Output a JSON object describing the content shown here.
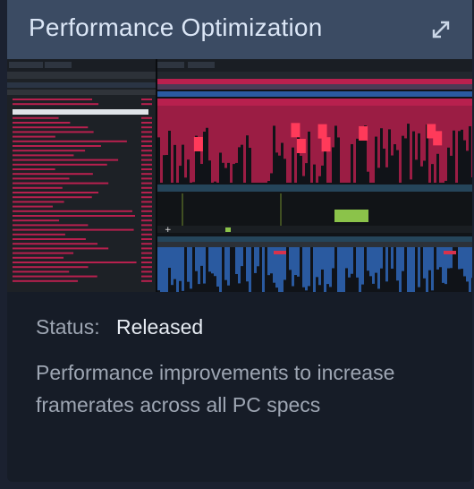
{
  "card": {
    "title": "Performance Optimization",
    "open_icon": "external-link-icon",
    "status_label": "Status:",
    "status_value": "Released",
    "description": "Performance improvements to increase framerates across all PC specs"
  },
  "colors": {
    "header_bg": "#3b4b63",
    "card_bg": "#161c27",
    "title_text": "#dbe6f6",
    "profiler_red": "#b8204e",
    "profiler_blue": "#2a5aa0",
    "profiler_green": "#8bc34a"
  }
}
